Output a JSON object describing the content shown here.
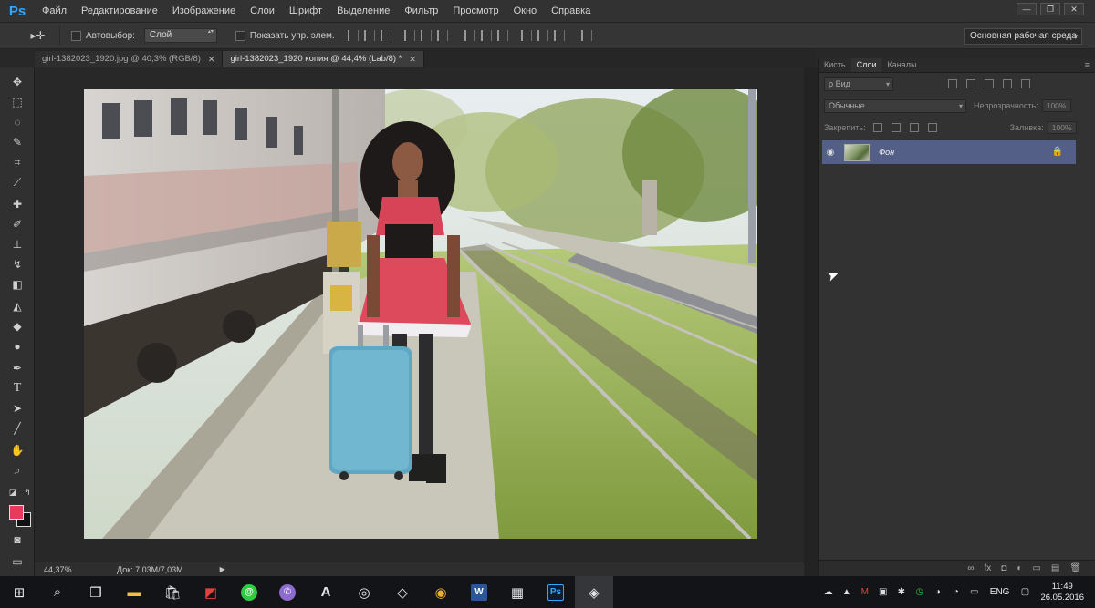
{
  "app": {
    "logo": "Ps",
    "menu": [
      "Файл",
      "Редактирование",
      "Изображение",
      "Слои",
      "Шрифт",
      "Выделение",
      "Фильтр",
      "Просмотр",
      "Окно",
      "Справка"
    ],
    "window_controls": [
      "—",
      "❐",
      "✕"
    ]
  },
  "options_bar": {
    "tool_glyph": "▸✛",
    "auto_select_label": "Автовыбор:",
    "auto_select_value": "Слой",
    "show_transform_label": "Показать упр. элем.",
    "workspace": "Основная рабочая среда"
  },
  "tabs": [
    {
      "label": "girl-1382023_1920.jpg @ 40,3% (RGB/8)",
      "close": "✕",
      "active": false
    },
    {
      "label": "girl-1382023_1920 копия @ 44,4% (Lab/8) *",
      "close": "✕",
      "active": true
    }
  ],
  "status": {
    "zoom": "44,37%",
    "doc": "Док: 7,03M/7,03M",
    "arrow": "▶"
  },
  "panel": {
    "tabs": [
      {
        "label": "Кисть",
        "active": false
      },
      {
        "label": "Слои",
        "active": true
      },
      {
        "label": "Каналы",
        "active": false
      }
    ],
    "menu_glyph": "≡",
    "kind_filter": "ρ Вид",
    "blend_mode": "Обычные",
    "opacity_label": "Непрозрачность:",
    "opacity_value": "100%",
    "lock_label": "Закрепить:",
    "fill_label": "Заливка:",
    "fill_value": "100%",
    "layer": {
      "name": "Фон",
      "eye": "◉",
      "lock": "🔒"
    },
    "footer_icons": [
      "∞",
      "fx",
      "◘",
      "◐",
      "▭",
      "▤",
      "🗑"
    ]
  },
  "taskbar": {
    "apps": [
      {
        "name": "start-icon",
        "glyph": "⊞"
      },
      {
        "name": "search-icon",
        "glyph": "⌕"
      },
      {
        "name": "task-view-icon",
        "glyph": "❒"
      },
      {
        "name": "explorer-icon",
        "glyph": "▬",
        "color": "#f0c040"
      },
      {
        "name": "store-icon",
        "glyph": "🛍"
      },
      {
        "name": "app-icon",
        "glyph": "◩",
        "color": "#e04040"
      },
      {
        "name": "messenger-icon",
        "glyph": "@",
        "color": "#2ecc40"
      },
      {
        "name": "viber-icon",
        "glyph": "✆",
        "color": "#8e6ccf"
      },
      {
        "name": "text-app-icon",
        "glyph": "A"
      },
      {
        "name": "camera-app-icon",
        "glyph": "◎"
      },
      {
        "name": "image-app-icon",
        "glyph": "◇"
      },
      {
        "name": "chrome-icon",
        "glyph": "◉",
        "color": "#e8b030"
      },
      {
        "name": "word-icon",
        "glyph": "W",
        "color": "#2b579a"
      },
      {
        "name": "calculator-icon",
        "glyph": "▦"
      },
      {
        "name": "photoshop-icon",
        "glyph": "Ps",
        "color": "#31a8ff"
      },
      {
        "name": "active-app-icon",
        "glyph": "◈"
      }
    ],
    "tray": {
      "icons": [
        "☁",
        "▲",
        "M",
        "▣",
        "✱",
        "◷",
        "◑",
        "◔",
        "▭"
      ],
      "language": "ENG",
      "notification": "▢",
      "time": "11:49",
      "date": "26.05.2016"
    }
  },
  "colors": {
    "foreground": "#e83a5b",
    "background": "#111111",
    "selection": "#535f86"
  }
}
